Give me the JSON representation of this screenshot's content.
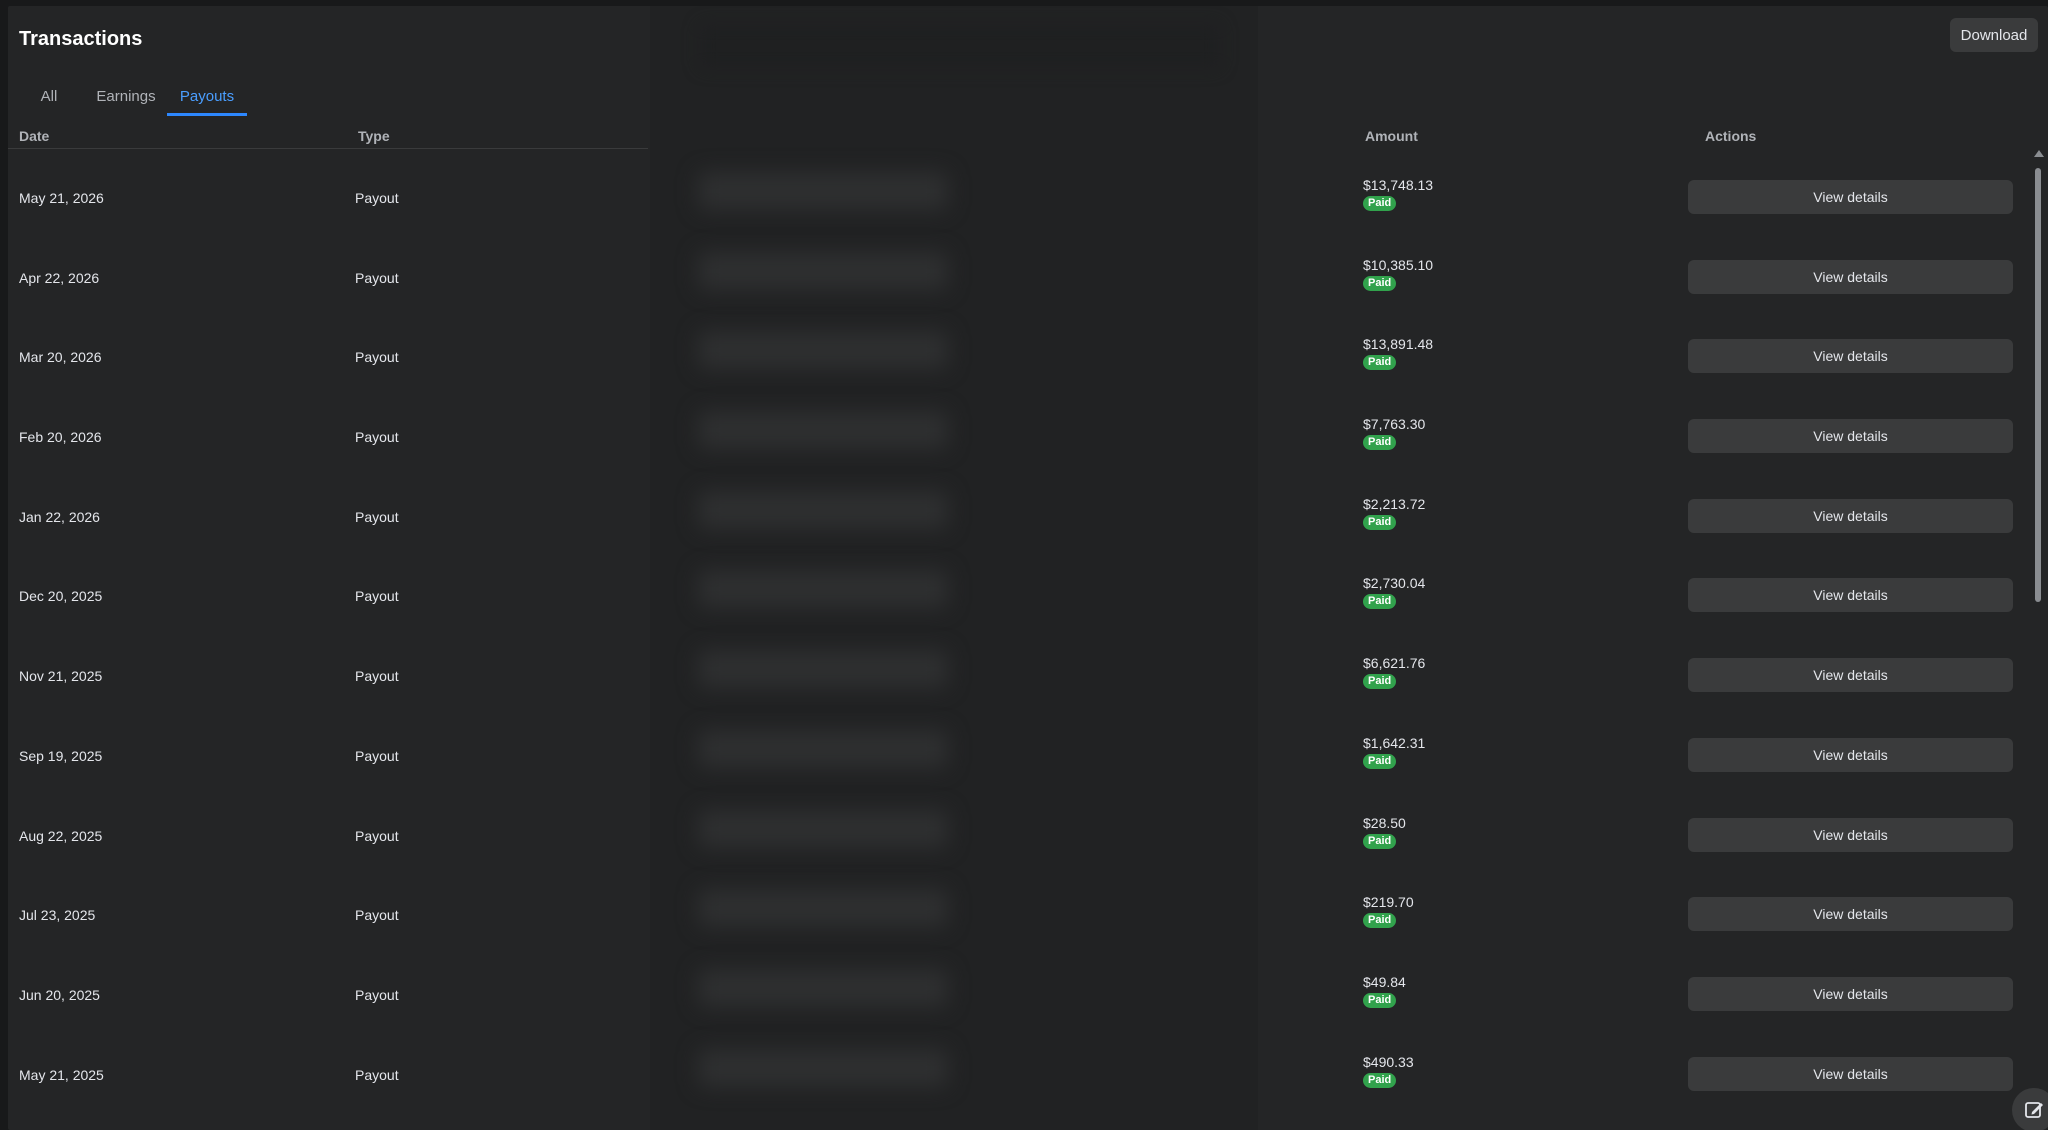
{
  "header": {
    "title": "Transactions",
    "download_label": "Download"
  },
  "tabs": [
    {
      "label": "All",
      "active": false
    },
    {
      "label": "Earnings",
      "active": false
    },
    {
      "label": "Payouts",
      "active": true
    }
  ],
  "columns": {
    "date": "Date",
    "type": "Type",
    "amount": "Amount",
    "actions": "Actions"
  },
  "rows": [
    {
      "date": "May 21, 2026",
      "type": "Payout",
      "amount": "$13,748.13",
      "status": "Paid",
      "action": "View details"
    },
    {
      "date": "Apr 22, 2026",
      "type": "Payout",
      "amount": "$10,385.10",
      "status": "Paid",
      "action": "View details"
    },
    {
      "date": "Mar 20, 2026",
      "type": "Payout",
      "amount": "$13,891.48",
      "status": "Paid",
      "action": "View details"
    },
    {
      "date": "Feb 20, 2026",
      "type": "Payout",
      "amount": "$7,763.30",
      "status": "Paid",
      "action": "View details"
    },
    {
      "date": "Jan 22, 2026",
      "type": "Payout",
      "amount": "$2,213.72",
      "status": "Paid",
      "action": "View details"
    },
    {
      "date": "Dec 20, 2025",
      "type": "Payout",
      "amount": "$2,730.04",
      "status": "Paid",
      "action": "View details"
    },
    {
      "date": "Nov 21, 2025",
      "type": "Payout",
      "amount": "$6,621.76",
      "status": "Paid",
      "action": "View details"
    },
    {
      "date": "Sep 19, 2025",
      "type": "Payout",
      "amount": "$1,642.31",
      "status": "Paid",
      "action": "View details"
    },
    {
      "date": "Aug 22, 2025",
      "type": "Payout",
      "amount": "$28.50",
      "status": "Paid",
      "action": "View details"
    },
    {
      "date": "Jul 23, 2025",
      "type": "Payout",
      "amount": "$219.70",
      "status": "Paid",
      "action": "View details"
    },
    {
      "date": "Jun 20, 2025",
      "type": "Payout",
      "amount": "$49.84",
      "status": "Paid",
      "action": "View details"
    },
    {
      "date": "May 21, 2025",
      "type": "Payout",
      "amount": "$490.33",
      "status": "Paid",
      "action": "View details"
    }
  ],
  "colors": {
    "background": "#242526",
    "active_tab": "#2d88ff",
    "paid_badge": "#31a24c",
    "button": "#3a3b3c"
  },
  "icons": {
    "edit": "edit-icon",
    "scroll_up": "scroll-up-arrow-icon"
  }
}
